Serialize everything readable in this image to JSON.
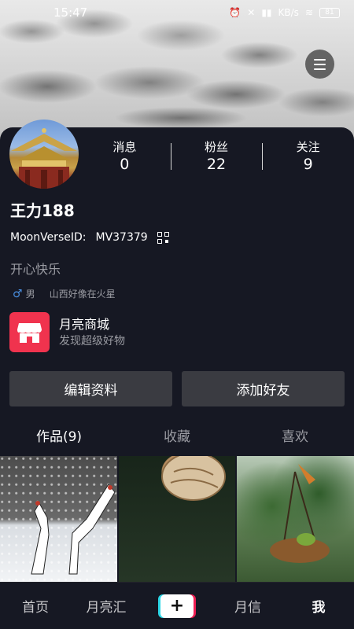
{
  "status_bar": {
    "time": "15:47",
    "network": "KB/s",
    "battery": "81"
  },
  "profile": {
    "name": "王力188",
    "id_label": "MoonVerseID:",
    "id_value": "MV37379",
    "bio": "开心快乐",
    "gender": "男",
    "location": "山西好像在火星"
  },
  "stats": [
    {
      "label": "消息",
      "value": "0"
    },
    {
      "label": "粉丝",
      "value": "22"
    },
    {
      "label": "关注",
      "value": "9"
    }
  ],
  "shop": {
    "title": "月亮商城",
    "subtitle": "发现超级好物"
  },
  "buttons": {
    "edit": "编辑资料",
    "add_friend": "添加好友"
  },
  "tabs": [
    "作品(9)",
    "收藏",
    "喜欢"
  ],
  "bottom_nav": [
    "首页",
    "月亮汇",
    "+",
    "月信",
    "我"
  ],
  "colors": {
    "background": "#161823",
    "accent_red": "#f0334e",
    "muted_text": "#9a9ba2"
  }
}
